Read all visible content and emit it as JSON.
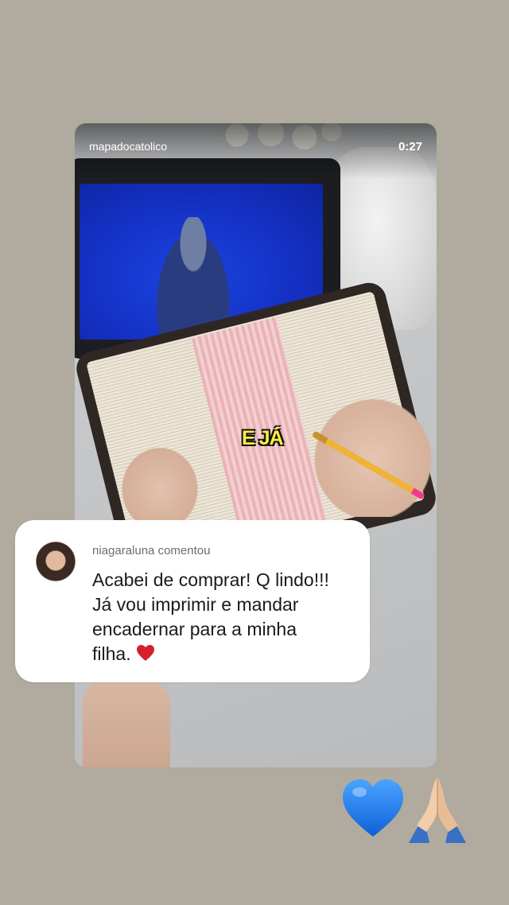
{
  "reel": {
    "username": "mapadocatolico",
    "timer": "0:27",
    "caption": "E JÁ"
  },
  "comment": {
    "header": "niagaraluna comentou",
    "lines": [
      "Acabei de comprar! Q lindo!!!",
      "Já vou imprimir e mandar",
      "encadernar para a minha",
      "filha."
    ],
    "emoji_icon": "red-heart-icon"
  },
  "stickers": [
    "blue-heart-icon",
    "praying-hands-icon"
  ],
  "colors": {
    "background": "#b0aa9f",
    "caption_yellow": "#f9ef3f",
    "tablet_blue": "#1431c4",
    "heart_red": "#d4202c",
    "heart_blue": "#1a7bf0"
  }
}
